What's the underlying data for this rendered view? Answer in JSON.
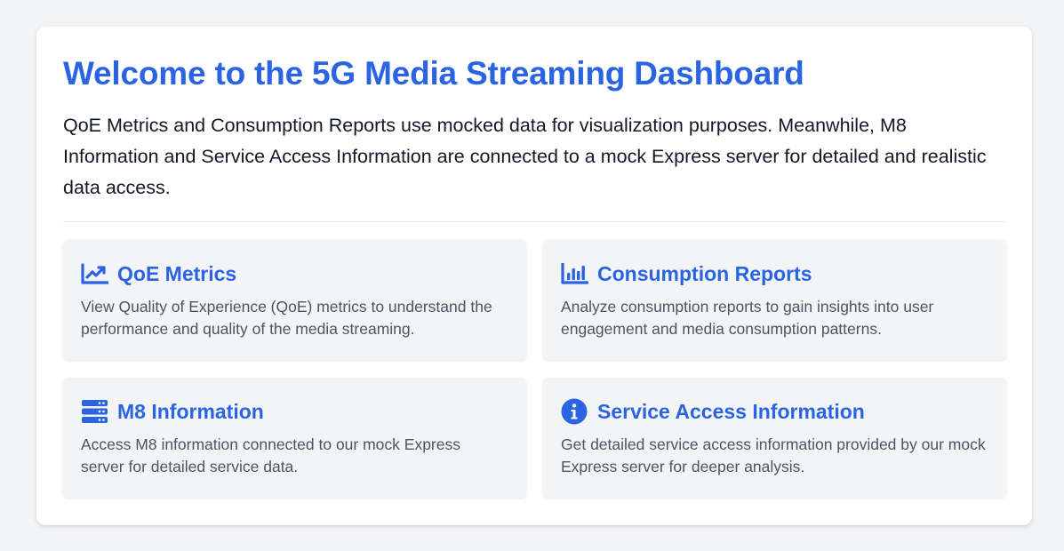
{
  "header": {
    "title": "Welcome to the 5G Media Streaming Dashboard",
    "intro": "QoE Metrics and Consumption Reports use mocked data for visualization purposes. Meanwhile, M8 Information and Service Access Information are connected to a mock Express server for detailed and realistic data access."
  },
  "colors": {
    "accent": "#2b64e3",
    "card_bg": "#f3f4f6",
    "page_bg": "#f3f4f6"
  },
  "cards": [
    {
      "icon": "chart-line-icon",
      "title": "QoE Metrics",
      "description": "View Quality of Experience (QoE) metrics to understand the performance and quality of the media streaming."
    },
    {
      "icon": "chart-bar-icon",
      "title": "Consumption Reports",
      "description": "Analyze consumption reports to gain insights into user engagement and media consumption patterns."
    },
    {
      "icon": "server-icon",
      "title": "M8 Information",
      "description": "Access M8 information connected to our mock Express server for detailed service data."
    },
    {
      "icon": "info-circle-icon",
      "title": "Service Access Information",
      "description": "Get detailed service access information provided by our mock Express server for deeper analysis."
    }
  ]
}
